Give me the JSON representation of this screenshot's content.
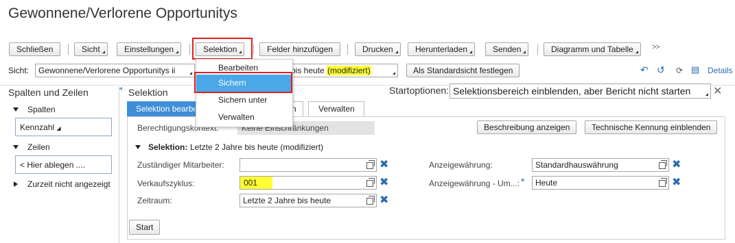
{
  "title": "Gewonnene/Verlorene Opportunitys",
  "toolbar": {
    "close": "Schließen",
    "view": "Sicht",
    "settings": "Einstellungen",
    "selection": "Selektion",
    "add_fields": "Felder hinzufügen",
    "print": "Drucken",
    "download": "Herunterladen",
    "send": "Senden",
    "chart_table": "Diagramm und Tabelle",
    "more": ">>"
  },
  "view_row": {
    "label": "Sicht:",
    "view_value": "Gewonnene/Verlorene Opportunitys ii",
    "selection_value_prefix": "bis heute",
    "selection_value_highlight": "(modifiziert)",
    "set_default": "Als Standardsicht festlegen",
    "details": "Details"
  },
  "menu": {
    "items": [
      "Bearbeiten",
      "Sichern",
      "Sichern unter",
      "Verwalten"
    ]
  },
  "left": {
    "header": "Spalten und Zeilen",
    "columns_label": "Spalten",
    "columns_item": "Kennzahl",
    "rows_label": "Zeilen",
    "rows_item": "< Hier ablegen ....",
    "hidden_label": "Zurzeit nicht angezeigt"
  },
  "selection_area": {
    "header": "Selektion",
    "start_options_label": "Startoptionen:",
    "start_options_value": "Selektionsbereich einblenden, aber Bericht nicht starten",
    "tabs": [
      "Selektion bearbe",
      "n",
      "Verwalten"
    ],
    "auth_label": "Berechtigungskontext:",
    "auth_value": "Keine Einschränkungen",
    "show_description": "Beschreibung anzeigen",
    "show_tech_id": "Technische Kennung einblenden",
    "selection_title": "Selektion:",
    "selection_summary": "Letzte 2 Jahre bis heute (modifiziert)",
    "fields": {
      "employee_label": "Zuständiger Mitarbeiter:",
      "employee_value": "",
      "sales_cycle_label": "Verkaufszyklus:",
      "sales_cycle_value": "001",
      "period_label": "Zeitraum:",
      "period_value": "Letzte 2 Jahre bis heute",
      "currency_label": "Anzeigewährung:",
      "currency_value": "Standardhauswährung",
      "currency_conv_label": "Anzeigewährung - Um...:",
      "currency_conv_required": "*",
      "currency_conv_value": "Heute"
    },
    "start": "Start"
  }
}
